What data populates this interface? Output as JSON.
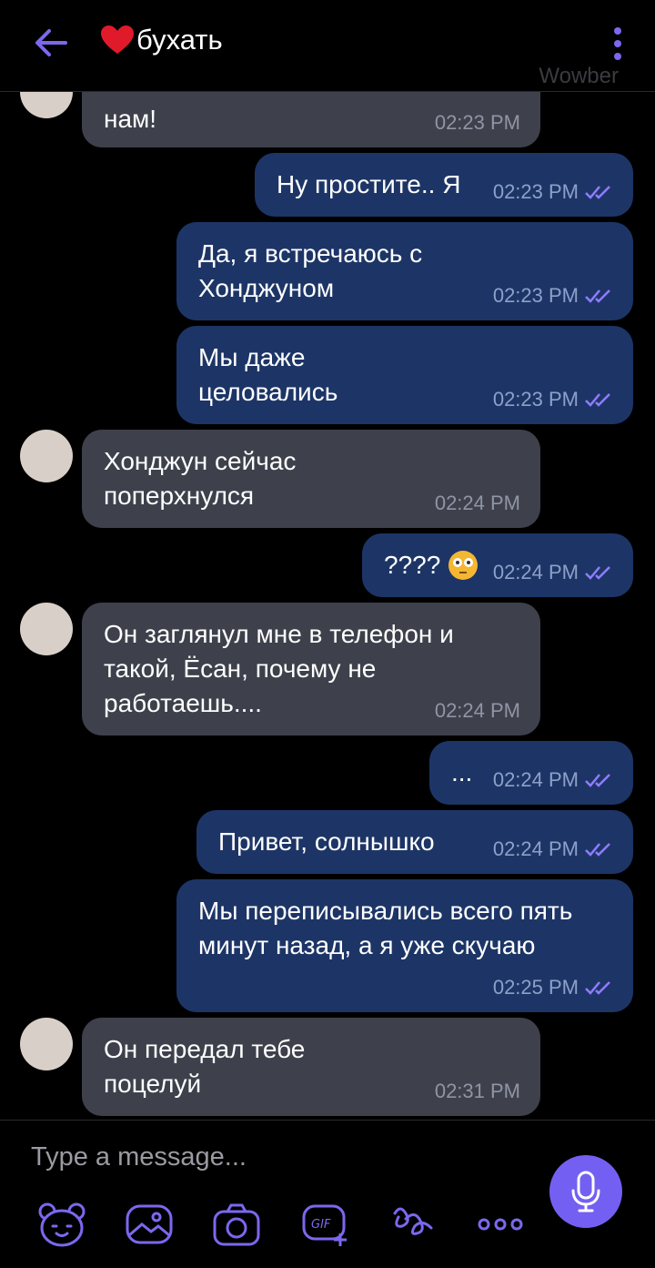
{
  "header": {
    "chat_title": "бухать",
    "watermark": "Wowber"
  },
  "messages": [
    {
      "dir": "in",
      "text": "нам!",
      "time": "02:23 PM",
      "avatar": true,
      "partial": true
    },
    {
      "dir": "out",
      "text": "Ну простите.. Я",
      "time": "02:23 PM"
    },
    {
      "dir": "out",
      "text": "Да, я встречаюсь с Хонджуном",
      "time": "02:23 PM"
    },
    {
      "dir": "out",
      "text": "Мы даже целовались",
      "time": "02:23 PM"
    },
    {
      "dir": "in",
      "text": "Хонджун сейчас поперхнулся",
      "time": "02:24 PM",
      "avatar": true
    },
    {
      "dir": "out",
      "text": "????",
      "emoji": "flushed-face",
      "time": "02:24 PM"
    },
    {
      "dir": "in",
      "text": "Он заглянул мне в телефон и такой, Ёсан, почему не работаешь....",
      "time": "02:24 PM",
      "avatar": true
    },
    {
      "dir": "out",
      "text": "...",
      "time": "02:24 PM"
    },
    {
      "dir": "out",
      "text": "Привет, солнышко",
      "time": "02:24 PM"
    },
    {
      "dir": "out",
      "text": "Мы переписывались всего пять минут назад, а я уже скучаю",
      "time": "02:25 PM"
    },
    {
      "dir": "in",
      "text": "Он передал тебе поцелуй",
      "time": "02:31 PM",
      "avatar": true
    }
  ],
  "composer": {
    "placeholder": "Type a message...",
    "tools": [
      "sticker-bear-icon",
      "gallery-icon",
      "camera-icon",
      "gif-icon",
      "doodle-icon",
      "more-icon"
    ]
  },
  "colors": {
    "accent": "#7360f2",
    "incoming_bubble": "#3e414b",
    "outgoing_bubble": "#1d3566",
    "background": "#000000"
  }
}
